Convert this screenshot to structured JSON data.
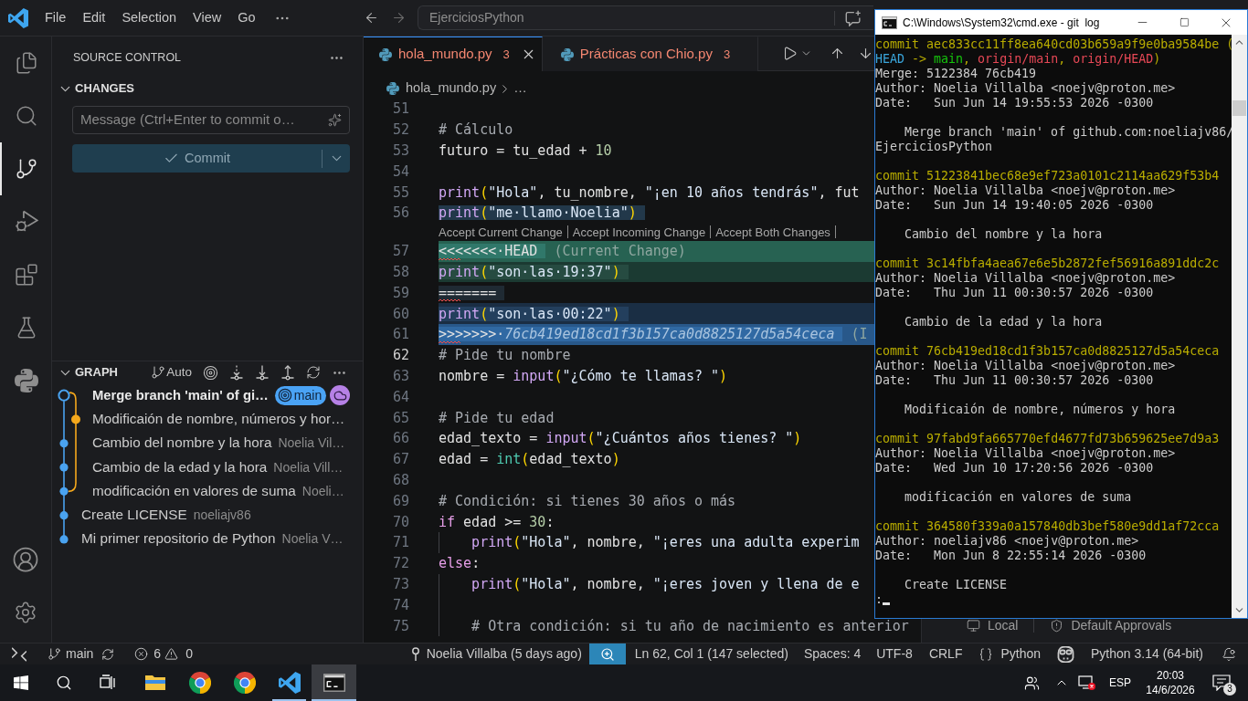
{
  "title_bar": {
    "menu": [
      "File",
      "Edit",
      "Selection",
      "View",
      "Go"
    ],
    "command_center": "EjerciciosPython"
  },
  "activity_bar": {
    "items": [
      {
        "kind": "explorer",
        "selected": false
      },
      {
        "kind": "search",
        "selected": false
      },
      {
        "kind": "source_control",
        "selected": true
      },
      {
        "kind": "run_debug",
        "selected": false
      },
      {
        "kind": "extensions",
        "selected": false
      },
      {
        "kind": "testing",
        "selected": false
      },
      {
        "kind": "python",
        "selected": false
      }
    ],
    "bottom": [
      {
        "kind": "account"
      },
      {
        "kind": "settings"
      }
    ]
  },
  "source_control": {
    "title": "SOURCE CONTROL",
    "changes": {
      "title": "CHANGES",
      "expanded": true,
      "message_field": {
        "placeholder": "Message (Ctrl+Enter to commit o…"
      },
      "commit_button": {
        "label": "Commit",
        "disabled": true
      }
    },
    "graph": {
      "title": "GRAPH",
      "expanded": true,
      "actions": [
        {
          "kind": "branch_mode",
          "label": "Auto"
        },
        {
          "kind": "target"
        },
        {
          "kind": "fetch"
        },
        {
          "kind": "pull"
        },
        {
          "kind": "push"
        },
        {
          "kind": "refresh"
        },
        {
          "kind": "more"
        }
      ],
      "commits": [
        {
          "message": "Merge branch 'main' of gi…",
          "kind": "merge",
          "color": "#4aa3f0",
          "current": true,
          "refs": [
            {
              "kind": "local",
              "label": "main"
            },
            {
              "kind": "remote"
            }
          ]
        },
        {
          "message": "Modificaión de nombre, números y hor…",
          "kind": "side",
          "color": "#f5a81c",
          "current": false
        },
        {
          "message": "Cambio del nombre y la hora",
          "author": "Noelia Vil…",
          "kind": "main",
          "color": "#4aa3f0",
          "current": false
        },
        {
          "message": "Cambio de la edad y la hora",
          "author": "Noelia Vill…",
          "kind": "main",
          "color": "#4aa3f0",
          "current": false
        },
        {
          "message": "modificación en valores de suma",
          "author": "Noeli…",
          "kind": "fork",
          "color": "#4aa3f0",
          "current": false
        },
        {
          "message": "Create LICENSE",
          "author": "noeliajv86",
          "kind": "main",
          "color": "#4aa3f0",
          "current": false
        },
        {
          "message": "Mi primer repositorio de Python",
          "author": "Noelia V…",
          "kind": "main",
          "color": "#4aa3f0",
          "current": false
        }
      ]
    }
  },
  "editor": {
    "tabs": [
      {
        "label": "hola_mundo.py",
        "problems": "3",
        "selected": true
      },
      {
        "label": "Prácticas con Chio.py",
        "problems": "3",
        "selected": false
      }
    ],
    "toolbar": [
      {
        "kind": "run"
      },
      {
        "kind": "run_menu"
      },
      {
        "kind": "previous"
      },
      {
        "kind": "next"
      }
    ],
    "breadcrumb": [
      "hola_mundo.py",
      "…"
    ],
    "lines": [
      {
        "kind": "code",
        "number": "51",
        "selected": false,
        "active": false,
        "indented": false
      },
      {
        "kind": "code",
        "number": "52",
        "selected": false,
        "active": false,
        "indented": false,
        "tokens": [
          {
            "text": "# Cálculo",
            "kind": "comment"
          }
        ]
      },
      {
        "kind": "code",
        "number": "53",
        "selected": false,
        "active": false,
        "indented": false,
        "tokens": [
          {
            "text": "futuro = tu_edad + ",
            "kind": "plain"
          },
          {
            "text": "10",
            "kind": "num"
          }
        ]
      },
      {
        "kind": "code",
        "number": "54",
        "selected": false,
        "active": false,
        "indented": false
      },
      {
        "kind": "code",
        "number": "55",
        "selected": false,
        "active": false,
        "indented": false,
        "tokens": [
          {
            "text": "print",
            "kind": "func"
          },
          {
            "text": "(",
            "kind": "bracket"
          },
          {
            "text": "\"Hola\"",
            "kind": "str"
          },
          {
            "text": ", tu_nombre, ",
            "kind": "plain"
          },
          {
            "text": "\"¡en 10 años tendrás\"",
            "kind": "str"
          },
          {
            "text": ", fut",
            "kind": "plain"
          }
        ]
      },
      {
        "kind": "code",
        "number": "56",
        "selected": true,
        "active": false,
        "indented": false,
        "tokens": [
          {
            "text": "print",
            "kind": "func"
          },
          {
            "text": "(",
            "kind": "bracket"
          },
          {
            "text": "\"me·llamo·Noelia\"",
            "kind": "str"
          },
          {
            "text": ")",
            "kind": "bracket"
          }
        ]
      },
      {
        "kind": "codelens",
        "actions": [
          "Accept Current Change",
          "Accept Incoming Change",
          "Accept Both Changes"
        ]
      },
      {
        "kind": "current_marker",
        "number": "57",
        "selected": true,
        "active": false,
        "indented": false,
        "tokens": [
          {
            "text": "<<<<<<<·HEAD",
            "kind": "marker"
          },
          {
            "text": " (Current Change)",
            "kind": "hint"
          }
        ]
      },
      {
        "kind": "current",
        "number": "58",
        "selected": true,
        "active": false,
        "indented": false,
        "tokens": [
          {
            "text": "print",
            "kind": "func"
          },
          {
            "text": "(",
            "kind": "bracket"
          },
          {
            "text": "\"son·las·19:37\"",
            "kind": "str"
          },
          {
            "text": ")",
            "kind": "bracket"
          }
        ]
      },
      {
        "kind": "separator",
        "number": "59",
        "selected": true,
        "active": false,
        "indented": false,
        "tokens": [
          {
            "text": "=======",
            "kind": "marker"
          }
        ]
      },
      {
        "kind": "incoming",
        "number": "60",
        "selected": true,
        "active": false,
        "indented": false,
        "tokens": [
          {
            "text": "print",
            "kind": "func"
          },
          {
            "text": "(",
            "kind": "bracket"
          },
          {
            "text": "\"son·las·00:22\"",
            "kind": "str"
          },
          {
            "text": ")",
            "kind": "bracket"
          }
        ]
      },
      {
        "kind": "incoming_marker",
        "number": "61",
        "selected": true,
        "active": false,
        "indented": false,
        "tokens": [
          {
            "text": ">>>>>>>·",
            "kind": "marker"
          },
          {
            "text": "76cb419ed18cd1f3b157ca0d8825127d5a54ceca",
            "kind": "hash"
          },
          {
            "text": " (I",
            "kind": "hint"
          }
        ]
      },
      {
        "kind": "code",
        "number": "62",
        "selected": false,
        "active": true,
        "indented": false,
        "tokens": [
          {
            "text": "# Pide tu nombre",
            "kind": "comment"
          }
        ]
      },
      {
        "kind": "code",
        "number": "63",
        "selected": false,
        "active": false,
        "indented": false,
        "tokens": [
          {
            "text": "nombre = ",
            "kind": "plain"
          },
          {
            "text": "input",
            "kind": "func"
          },
          {
            "text": "(",
            "kind": "bracket"
          },
          {
            "text": "\"¿Cómo te llamas? \"",
            "kind": "str"
          },
          {
            "text": ")",
            "kind": "bracket"
          }
        ]
      },
      {
        "kind": "code",
        "number": "64",
        "selected": false,
        "active": false,
        "indented": false
      },
      {
        "kind": "code",
        "number": "65",
        "selected": false,
        "active": false,
        "indented": false,
        "tokens": [
          {
            "text": "# Pide tu edad",
            "kind": "comment"
          }
        ]
      },
      {
        "kind": "code",
        "number": "66",
        "selected": false,
        "active": false,
        "indented": false,
        "tokens": [
          {
            "text": "edad_texto = ",
            "kind": "plain"
          },
          {
            "text": "input",
            "kind": "func"
          },
          {
            "text": "(",
            "kind": "bracket"
          },
          {
            "text": "\"¿Cuántos años tienes? \"",
            "kind": "str"
          },
          {
            "text": ")",
            "kind": "bracket"
          }
        ]
      },
      {
        "kind": "code",
        "number": "67",
        "selected": false,
        "active": false,
        "indented": false,
        "tokens": [
          {
            "text": "edad = ",
            "kind": "plain"
          },
          {
            "text": "int",
            "kind": "builtin"
          },
          {
            "text": "(",
            "kind": "bracket"
          },
          {
            "text": "edad_texto",
            "kind": "plain"
          },
          {
            "text": ")",
            "kind": "bracket"
          }
        ]
      },
      {
        "kind": "code",
        "number": "68",
        "selected": false,
        "active": false,
        "indented": false
      },
      {
        "kind": "code",
        "number": "69",
        "selected": false,
        "active": false,
        "indented": false,
        "tokens": [
          {
            "text": "# Condición: si tienes 30 años o más",
            "kind": "comment"
          }
        ]
      },
      {
        "kind": "code",
        "number": "70",
        "selected": false,
        "active": false,
        "indented": false,
        "tokens": [
          {
            "text": "if",
            "kind": "keyword"
          },
          {
            "text": " edad >= ",
            "kind": "plain"
          },
          {
            "text": "30",
            "kind": "num"
          },
          {
            "text": ":",
            "kind": "plain"
          }
        ]
      },
      {
        "kind": "code",
        "number": "71",
        "selected": false,
        "active": false,
        "indented": true,
        "tokens": [
          {
            "text": "print",
            "kind": "func"
          },
          {
            "text": "(",
            "kind": "bracket"
          },
          {
            "text": "\"Hola\"",
            "kind": "str"
          },
          {
            "text": ", nombre, ",
            "kind": "plain"
          },
          {
            "text": "\"¡eres una adulta experim",
            "kind": "str"
          }
        ]
      },
      {
        "kind": "code",
        "number": "72",
        "selected": false,
        "active": false,
        "indented": false,
        "tokens": [
          {
            "text": "else",
            "kind": "keyword"
          },
          {
            "text": ":",
            "kind": "plain"
          }
        ]
      },
      {
        "kind": "code",
        "number": "73",
        "selected": false,
        "active": false,
        "indented": true,
        "tokens": [
          {
            "text": "print",
            "kind": "func"
          },
          {
            "text": "(",
            "kind": "bracket"
          },
          {
            "text": "\"Hola\"",
            "kind": "str"
          },
          {
            "text": ", nombre, ",
            "kind": "plain"
          },
          {
            "text": "\"¡eres joven y llena de e",
            "kind": "str"
          }
        ]
      },
      {
        "kind": "code",
        "number": "74",
        "selected": false,
        "active": false,
        "indented": true
      },
      {
        "kind": "code",
        "number": "75",
        "selected": false,
        "active": false,
        "indented": true,
        "tokens": [
          {
            "text": "# Otra condición: si tu año de nacimiento es anterior",
            "kind": "comment"
          }
        ]
      }
    ]
  },
  "secondary_panel": {
    "chips": [
      {
        "kind": "local",
        "label": "Local"
      },
      {
        "kind": "approvals",
        "label": "Default Approvals"
      }
    ]
  },
  "status_bar": {
    "branch": "main",
    "errors": "6",
    "warnings": "0",
    "blame": "Noelia Villalba (5 days ago)",
    "position": "Ln 62, Col 1 (147 selected)",
    "indentation": "Spaces: 4",
    "encoding": "UTF-8",
    "line_ending": "CRLF",
    "language": "Python",
    "interpreter": "Python 3.14 (64-bit)"
  },
  "terminal_window": {
    "title": "C:\\Windows\\System32\\cmd.exe - git  log",
    "commits": [
      {
        "hash_line": "commit aec833cc11ff8ea640cd03b659a9f9e0ba9584be (",
        "refs": [
          {
            "text": "HEAD",
            "kind": "head"
          },
          {
            "text": " -> ",
            "kind": "punct"
          },
          {
            "text": "main",
            "kind": "local"
          },
          {
            "text": ", ",
            "kind": "punct"
          },
          {
            "text": "origin/main",
            "kind": "remote"
          },
          {
            "text": ", ",
            "kind": "punct"
          },
          {
            "text": "origin/HEAD",
            "kind": "remote"
          },
          {
            "text": ")",
            "kind": "punct"
          }
        ],
        "merge": "Merge: 5122384 76cb419",
        "author": "Author: Noelia Villalba <noejv@proton.me>",
        "date": "Date:   Sun Jun 14 19:55:53 2026 -0300",
        "message": "Merge branch 'main' of github.com:noeliajv86/EjerciciosPython"
      },
      {
        "hash_line": "commit 51223841bec68e9ef723a0101c2114aa629f53b4",
        "author": "Author: Noelia Villalba <noejv@proton.me>",
        "date": "Date:   Sun Jun 14 19:40:05 2026 -0300",
        "message": "Cambio del nombre y la hora"
      },
      {
        "hash_line": "commit 3c14fbfa4aea67e6e5b2872fef56916a891ddc2c",
        "author": "Author: Noelia Villalba <noejv@proton.me>",
        "date": "Date:   Thu Jun 11 00:30:57 2026 -0300",
        "message": "Cambio de la edad y la hora"
      },
      {
        "hash_line": "commit 76cb419ed18cd1f3b157ca0d8825127d5a54ceca",
        "author": "Author: Noelia Villalba <noejv@proton.me>",
        "date": "Date:   Thu Jun 11 00:30:57 2026 -0300",
        "message": "Modificaión de nombre, números y hora"
      },
      {
        "hash_line": "commit 97fabd9fa665770efd4677fd73b659625ee7d9a3",
        "author": "Author: Noelia Villalba <noejv@proton.me>",
        "date": "Date:   Wed Jun 10 17:20:56 2026 -0300",
        "message": "modificación en valores de suma"
      },
      {
        "hash_line": "commit 364580f339a0a157840db3bef580e9dd1af72cca",
        "author": "Author: noeliajv86 <noejv@proton.me>",
        "date": "Date:   Mon Jun 8 22:55:14 2026 -0300",
        "message": "Create LICENSE"
      }
    ],
    "prompt": ":"
  },
  "taskbar": {
    "buttons": [
      {
        "kind": "start"
      },
      {
        "kind": "search"
      },
      {
        "kind": "task_view"
      }
    ],
    "apps": [
      {
        "kind": "file_explorer",
        "running": false,
        "selected": false
      },
      {
        "kind": "chrome",
        "running": false,
        "selected": false
      },
      {
        "kind": "chrome",
        "running": false,
        "selected": false
      },
      {
        "kind": "vscode",
        "running": true,
        "selected": false
      },
      {
        "kind": "console",
        "running": true,
        "selected": true
      }
    ],
    "tray": {
      "language": "ESP",
      "time": "20:03",
      "date": "14/6/2026",
      "notifications": "3"
    }
  }
}
